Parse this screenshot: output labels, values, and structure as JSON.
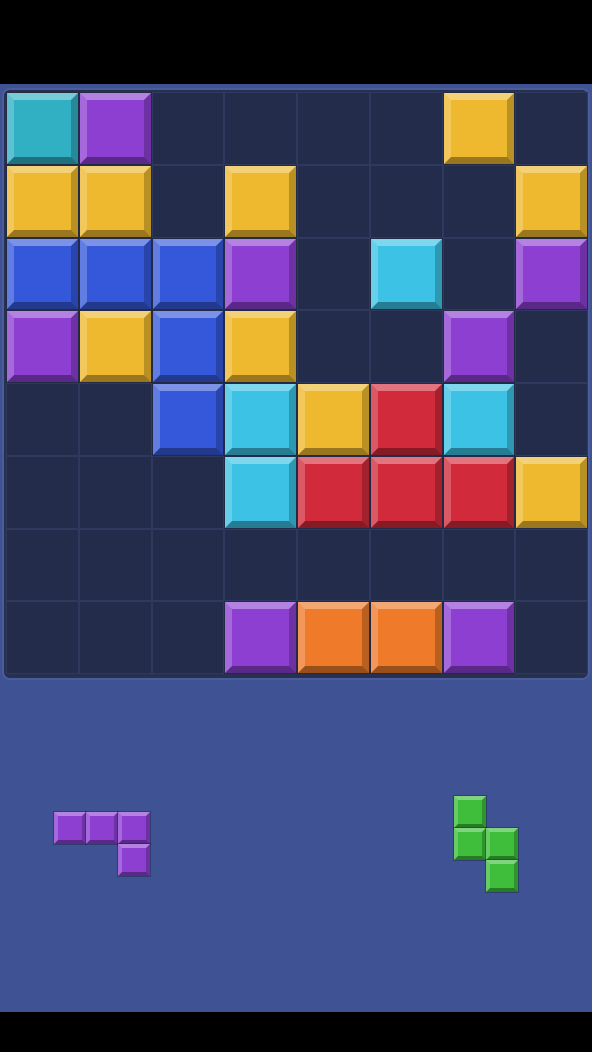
{
  "board": {
    "cols": 8,
    "rows": 8,
    "cells": [
      [
        "teal",
        "purple",
        null,
        null,
        null,
        null,
        "yellow",
        null
      ],
      [
        "yellow",
        "yellow",
        null,
        "yellow",
        null,
        null,
        null,
        "yellow"
      ],
      [
        "blue",
        "blue",
        "blue",
        "purple",
        null,
        "cyan",
        null,
        "purple"
      ],
      [
        "purple",
        "yellow",
        "blue",
        "yellow",
        null,
        null,
        "purple",
        null
      ],
      [
        null,
        null,
        "blue",
        "cyan",
        "yellow",
        "red",
        "cyan",
        null
      ],
      [
        null,
        null,
        null,
        "cyan",
        "red",
        "red",
        "red",
        "yellow"
      ],
      [
        null,
        null,
        null,
        null,
        null,
        null,
        null,
        null
      ],
      [
        null,
        null,
        null,
        "purple",
        "orange",
        "orange",
        "purple",
        null
      ]
    ]
  },
  "tray": {
    "pieces": [
      {
        "name": "purple-j-piece",
        "color": "purple",
        "cells": [
          [
            0,
            0
          ],
          [
            1,
            0
          ],
          [
            2,
            0
          ],
          [
            2,
            1
          ]
        ]
      },
      {
        "name": "green-s-piece",
        "color": "green",
        "cells": [
          [
            0,
            0
          ],
          [
            0,
            1
          ],
          [
            1,
            1
          ],
          [
            1,
            2
          ]
        ]
      }
    ]
  },
  "colors": {
    "teal": "#31afc3",
    "purple": "#8c3fd1",
    "yellow": "#eeb92f",
    "blue": "#3558da",
    "cyan": "#3bc2e4",
    "red": "#d12a3a",
    "orange": "#ee7a2a",
    "green": "#3ebe3a"
  }
}
